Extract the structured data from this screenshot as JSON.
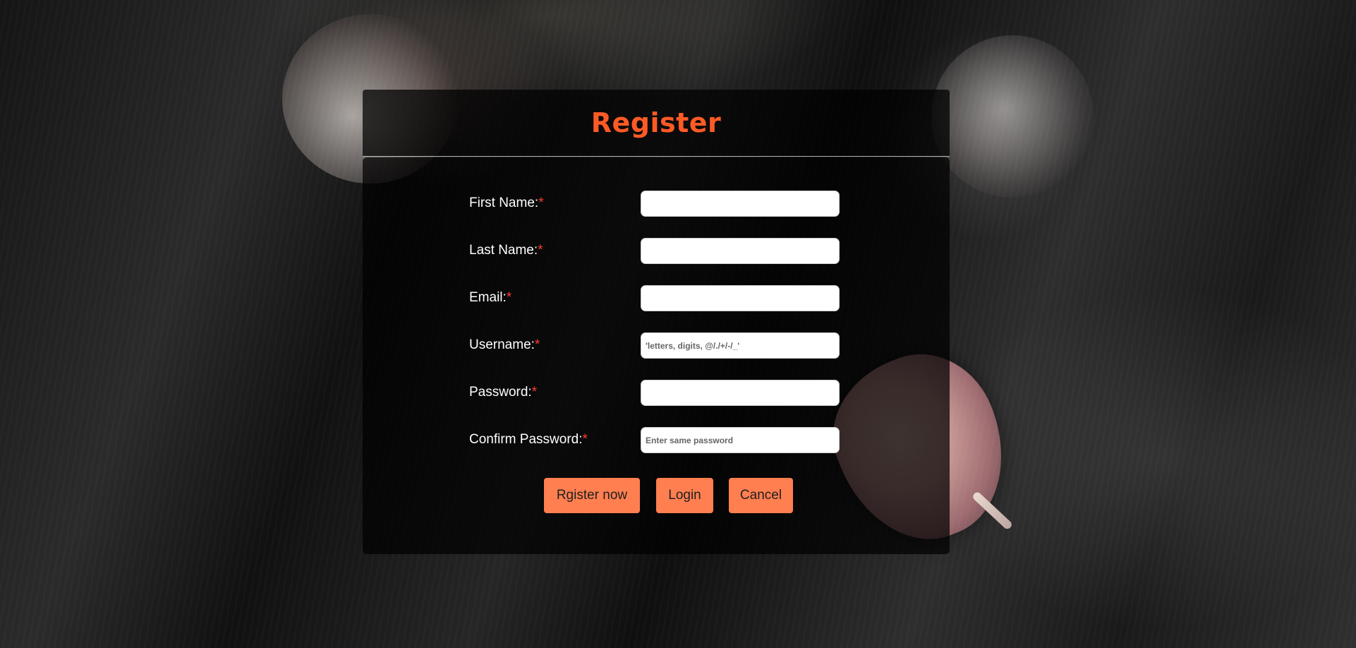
{
  "page": {
    "title": "Register"
  },
  "form": {
    "required_marker": "*",
    "fields": [
      {
        "label": "First Name:",
        "value": "",
        "placeholder": ""
      },
      {
        "label": "Last Name:",
        "value": "",
        "placeholder": ""
      },
      {
        "label": "Email:",
        "value": "",
        "placeholder": ""
      },
      {
        "label": "Username:",
        "value": "",
        "placeholder": "'letters, digits, @/./+/-/_'"
      },
      {
        "label": "Password:",
        "value": "",
        "placeholder": ""
      },
      {
        "label": "Confirm Password:",
        "value": "",
        "placeholder": "Enter same password"
      }
    ],
    "buttons": {
      "register": "Rgister now",
      "login": "Login",
      "cancel": "Cancel"
    }
  },
  "colors": {
    "accent": "#ff7f50",
    "title": "#ff5a26",
    "required": "#ff3b2f"
  }
}
